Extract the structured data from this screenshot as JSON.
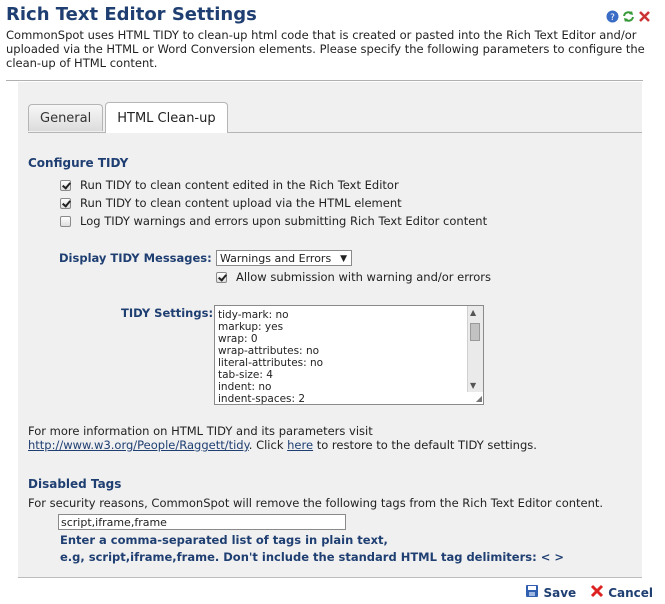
{
  "header": {
    "title": "Rich Text Editor Settings",
    "intro": "CommonSpot uses HTML TIDY to clean-up html code that is created or pasted into the Rich Text Editor and/or uploaded via the HTML or Word Conversion elements. Please specify the following parameters to configure the clean-up of HTML content."
  },
  "tabs": [
    {
      "label": "General"
    },
    {
      "label": "HTML Clean-up"
    }
  ],
  "configure_tidy": {
    "title": "Configure TIDY",
    "options": [
      {
        "label": "Run TIDY to clean content edited in the Rich Text Editor",
        "checked": true
      },
      {
        "label": "Run TIDY to clean content upload via the HTML element",
        "checked": true
      },
      {
        "label": "Log TIDY warnings and errors upon submitting Rich Text Editor content",
        "checked": false
      }
    ]
  },
  "display_messages": {
    "label": "Display TIDY Messages:",
    "selected": "Warnings and Errors",
    "allow_label": "Allow submission with warning and/or errors",
    "allow_checked": true
  },
  "tidy_settings": {
    "label": "TIDY Settings:",
    "lines": [
      "tidy-mark: no",
      "markup: yes",
      "wrap: 0",
      "wrap-attributes: no",
      "literal-attributes: no",
      "tab-size: 4",
      "indent: no",
      "indent-spaces: 2"
    ]
  },
  "info": {
    "line1": "For more information on HTML TIDY and its parameters visit",
    "link": "http://www.w3.org/People/Raggett/tidy",
    "mid": ". Click ",
    "here": "here",
    "end": " to restore to the default TIDY settings."
  },
  "disabled_tags": {
    "title": "Disabled Tags",
    "description": "For security reasons, CommonSpot will remove the following tags from the Rich Text Editor content.",
    "value": "script,iframe,frame",
    "hint1": "Enter a comma-separated list of tags in plain text,",
    "hint2": "e.g, script,iframe,frame. Don't include the standard HTML tag delimiters: < >"
  },
  "buttons": {
    "save": "Save",
    "cancel": "Cancel"
  },
  "colors": {
    "accent": "#1f3f72",
    "panel": "#f0f0f0"
  }
}
